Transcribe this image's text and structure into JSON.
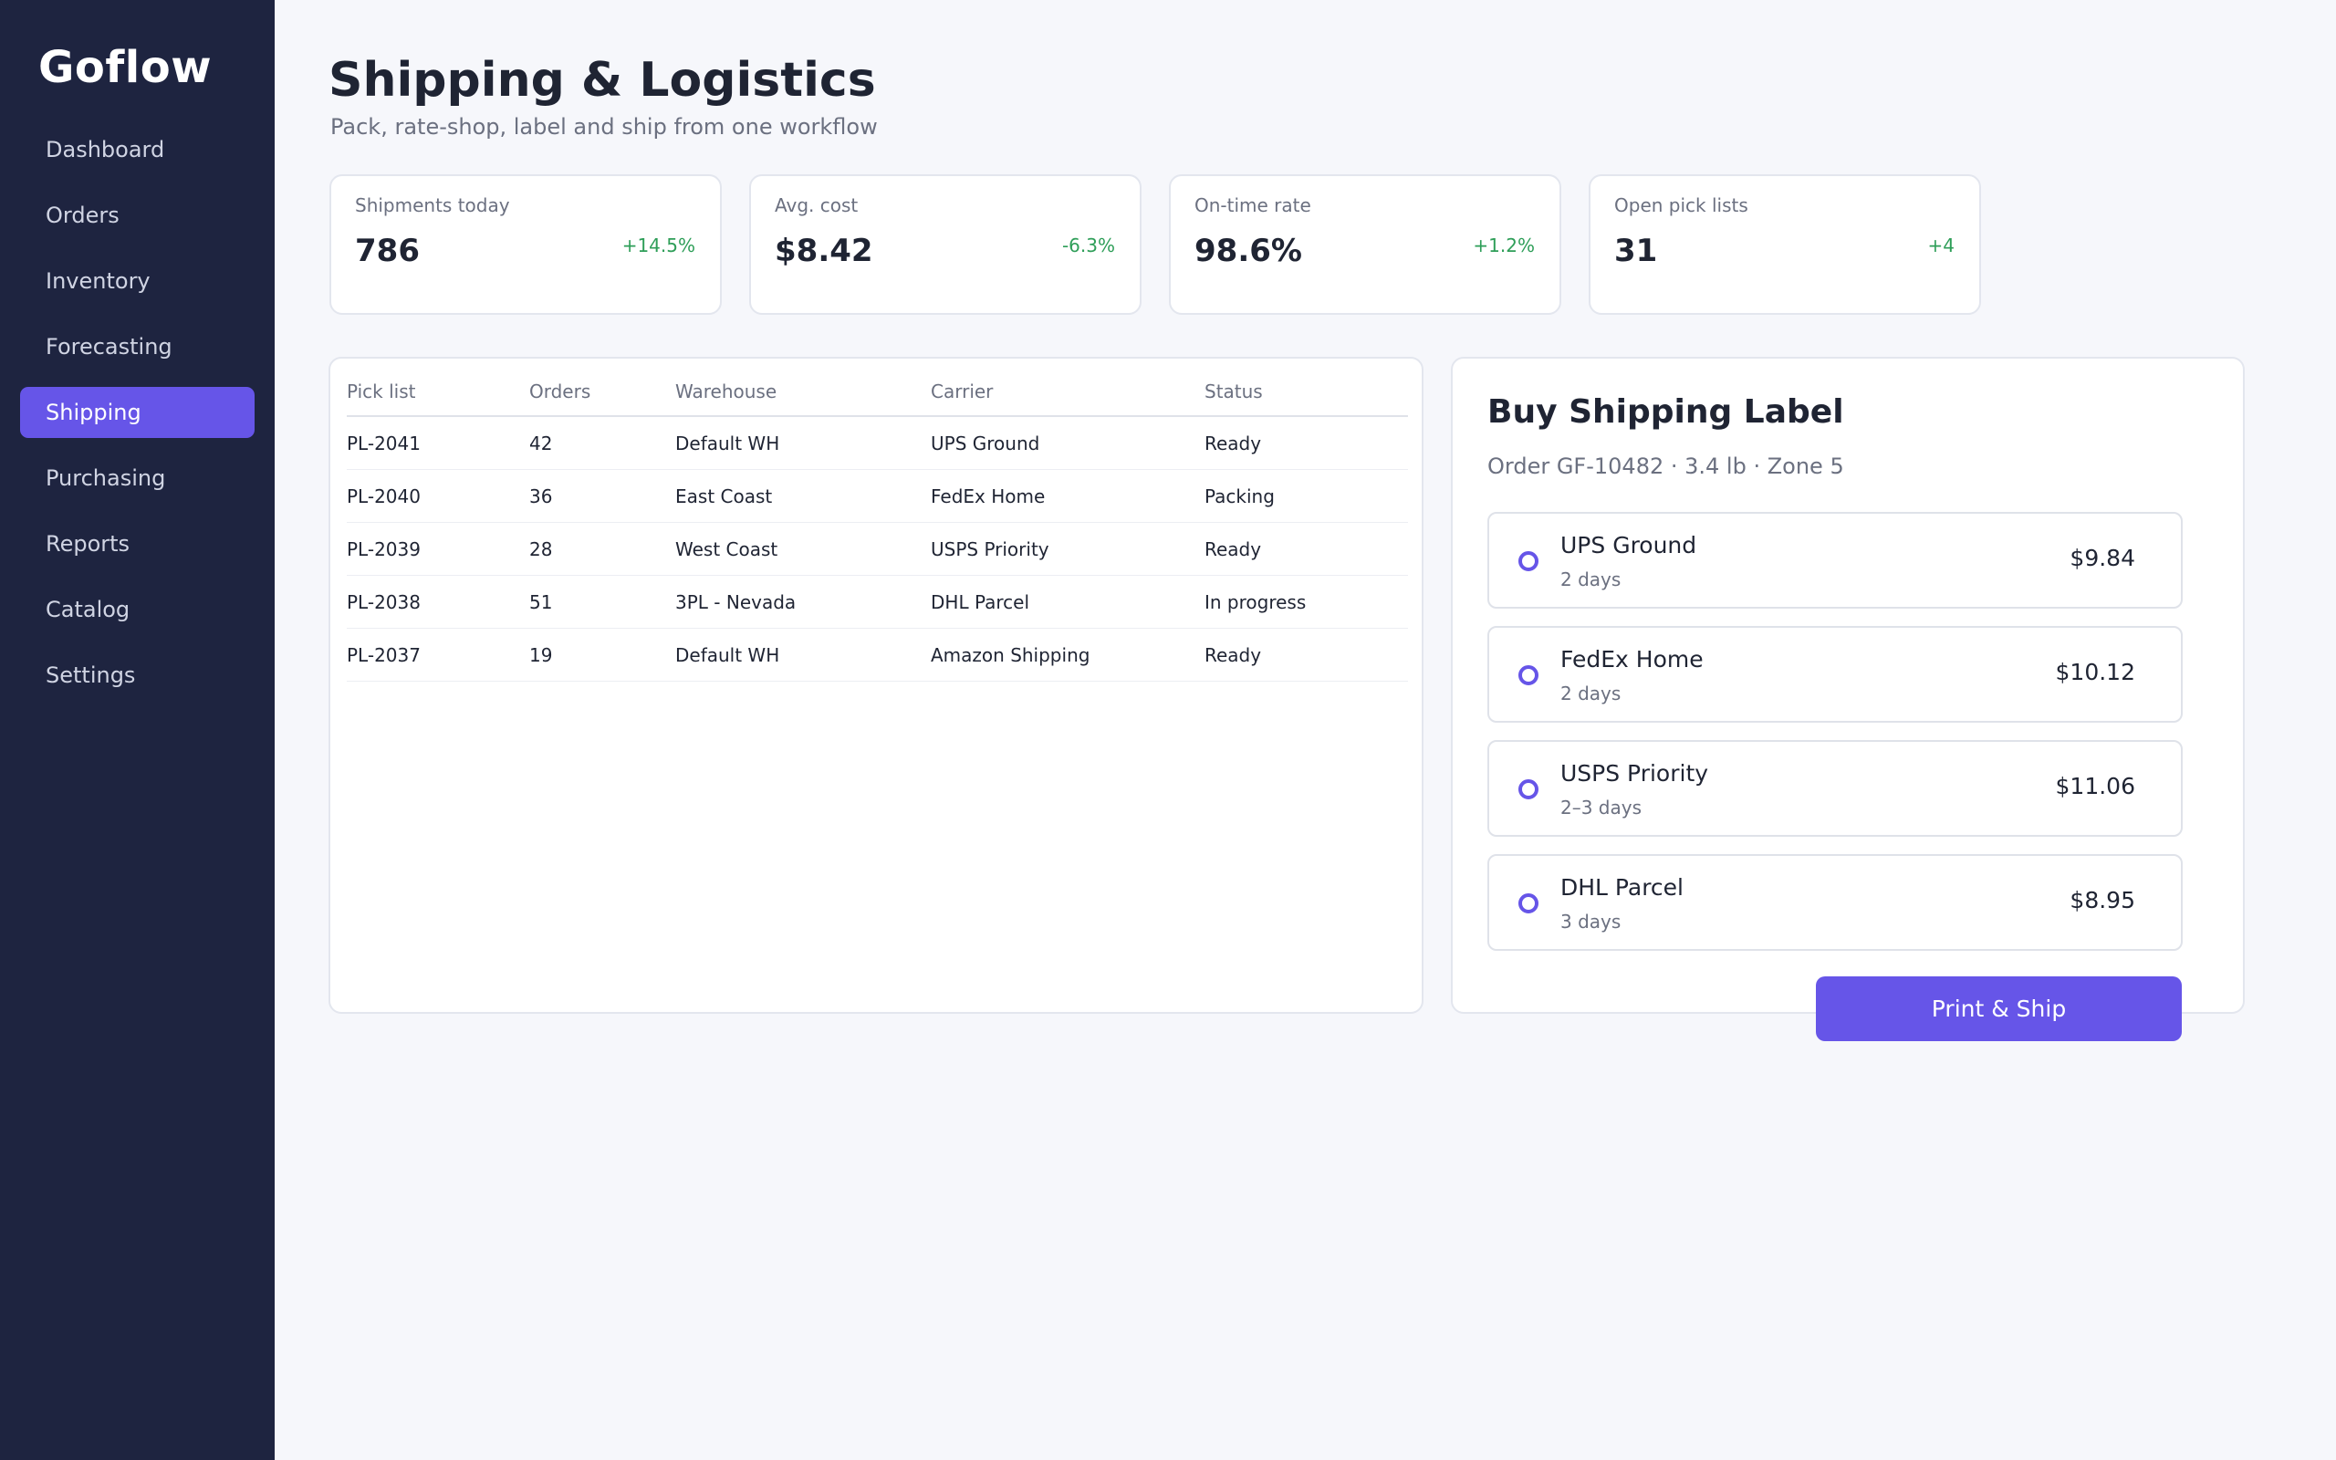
{
  "app": {
    "name": "Goflow"
  },
  "sidebar": {
    "items": [
      {
        "label": "Dashboard"
      },
      {
        "label": "Orders"
      },
      {
        "label": "Inventory"
      },
      {
        "label": "Forecasting"
      },
      {
        "label": "Shipping",
        "active": true
      },
      {
        "label": "Purchasing"
      },
      {
        "label": "Reports"
      },
      {
        "label": "Catalog"
      },
      {
        "label": "Settings"
      }
    ]
  },
  "header": {
    "title": "Shipping & Logistics",
    "subtitle": "Pack, rate-shop, label and ship from one workflow"
  },
  "kpis": [
    {
      "label": "Shipments today",
      "value": "786",
      "delta": "+14.5%"
    },
    {
      "label": "Avg. cost",
      "value": "$8.42",
      "delta": "-6.3%"
    },
    {
      "label": "On-time rate",
      "value": "98.6%",
      "delta": "+1.2%"
    },
    {
      "label": "Open pick lists",
      "value": "31",
      "delta": "+4"
    }
  ],
  "pick_table": {
    "columns": [
      "Pick list",
      "Orders",
      "Warehouse",
      "Carrier",
      "Status"
    ],
    "rows": [
      [
        "PL-2041",
        "42",
        "Default WH",
        "UPS Ground",
        "Ready"
      ],
      [
        "PL-2040",
        "36",
        "East Coast",
        "FedEx Home",
        "Packing"
      ],
      [
        "PL-2039",
        "28",
        "West Coast",
        "USPS Priority",
        "Ready"
      ],
      [
        "PL-2038",
        "51",
        "3PL - Nevada",
        "DHL Parcel",
        "In progress"
      ],
      [
        "PL-2037",
        "19",
        "Default WH",
        "Amazon Shipping",
        "Ready"
      ]
    ]
  },
  "label_panel": {
    "title": "Buy Shipping Label",
    "subtitle": "Order GF-10482 · 3.4 lb · Zone 5",
    "rates": [
      {
        "carrier": "UPS Ground",
        "eta": "2 days",
        "price": "$9.84"
      },
      {
        "carrier": "FedEx Home",
        "eta": "2 days",
        "price": "$10.12"
      },
      {
        "carrier": "USPS Priority",
        "eta": "2–3 days",
        "price": "$11.06"
      },
      {
        "carrier": "DHL Parcel",
        "eta": "3 days",
        "price": "$8.95"
      }
    ],
    "action_label": "Print & Ship"
  },
  "colors": {
    "sidebar_bg": "#1e2440",
    "accent": "#6655e8",
    "positive": "#2e9e58",
    "page_bg": "#f6f7fb"
  }
}
